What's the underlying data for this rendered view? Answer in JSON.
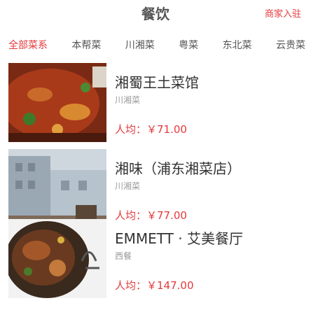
{
  "header": {
    "title": "餐饮",
    "merchant_entry": "商家入驻"
  },
  "tabs": [
    "全部菜系",
    "本帮菜",
    "川湘菜",
    "粤菜",
    "东北菜",
    "云贵菜"
  ],
  "restaurants": [
    {
      "name": "湘蜀王土菜馆",
      "category": "川湘菜",
      "price": "人均：￥71.00",
      "image_icon": "spicy-dish-photo"
    },
    {
      "name": "湘味（浦东湘菜店）",
      "category": "川湘菜",
      "price": "人均：￥77.00",
      "image_icon": "building-photo"
    },
    {
      "name": "EMMETT · 艾美餐厅",
      "category": "西餐",
      "price": "人均：￥147.00",
      "image_icon": "steak-dish-photo"
    }
  ],
  "colors": {
    "accent": "#e4393c",
    "text": "#333333",
    "muted": "#999999"
  }
}
